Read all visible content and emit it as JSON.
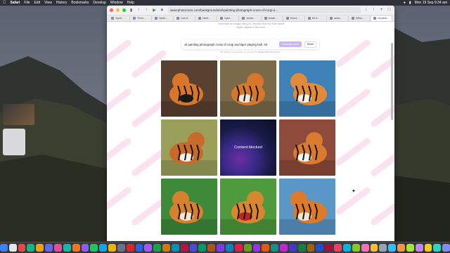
{
  "menubar": {
    "apple": "",
    "items": [
      "Safari",
      "File",
      "Edit",
      "View",
      "History",
      "Bookmarks",
      "Develop",
      "Window",
      "Help"
    ],
    "clock": "Mon 19 Sep 9:34 am"
  },
  "browser": {
    "url": "www.photoroom.com/backgrounds/oil-painting-photograph-cross-of-corgi-a...",
    "tabs": [
      "Synth...",
      "Thum...",
      "Synth...",
      "List of...",
      "Ident...",
      "hybri...",
      "Isolati...",
      "Isolati...",
      "Wood...",
      "ML fr...",
      "rainw...",
      "Diffus...",
      "oil painti..."
    ],
    "active_tab_index": 12
  },
  "page": {
    "top_note_line1": "Generate an image using AI. Beware that the final result",
    "top_note_line2": "might require a few tries.",
    "prompt_value": "oil painting photograph cross of corgi and tiger playing ball, 4K",
    "generate_label": "Generate more",
    "reset_label": "Reset",
    "terms_prefix": "By clicking on Generate, you accept the ",
    "terms_link": "Stable Diffusion license",
    "blocked_label": "Content blocked"
  },
  "tiles": [
    {
      "kind": "image",
      "bg": "#5a4030",
      "subject": "#d9762a",
      "accent": "#1b1b1b"
    },
    {
      "kind": "image",
      "bg": "#7a6a4a",
      "subject": "#d8762b",
      "accent": "#f1e8dc"
    },
    {
      "kind": "image",
      "bg": "#3f82b8",
      "subject": "#e08a3a",
      "accent": "#f6efe5"
    },
    {
      "kind": "image",
      "bg": "#9aa05a",
      "subject": "#c86a2a",
      "accent": "#f4f1ea"
    },
    {
      "kind": "blocked"
    },
    {
      "kind": "image",
      "bg": "#8e4a3a",
      "subject": "#d87a30",
      "accent": "#f5f5f5"
    },
    {
      "kind": "image",
      "bg": "#3e8a3a",
      "subject": "#d7812f",
      "accent": "#efe6d6"
    },
    {
      "kind": "image",
      "bg": "#4e9a3c",
      "subject": "#d9872f",
      "accent": "#b8262a"
    },
    {
      "kind": "image",
      "bg": "#5a96c6",
      "subject": "#de7a2a",
      "accent": "#f0e5d5"
    }
  ],
  "dock_colors": [
    "#3b82f6",
    "#e5e7eb",
    "#ef4444",
    "#10b981",
    "#f59e0b",
    "#6366f1",
    "#ec4899",
    "#14b8a6",
    "#f97316",
    "#8b5cf6",
    "#22c55e",
    "#0ea5e9",
    "#eab308",
    "#64748b",
    "#dc2626",
    "#2563eb",
    "#a855f7",
    "#16a34a",
    "#d97706",
    "#0891b2",
    "#be123c",
    "#4f46e5",
    "#059669",
    "#b45309",
    "#7c3aed",
    "#0284c7",
    "#e11d48",
    "#65a30d",
    "#9333ea",
    "#ea580c",
    "#0d9488",
    "#c026d3",
    "#4338ca",
    "#15803d",
    "#a16207",
    "#1d4ed8",
    "#9f1239",
    "#f43f5e",
    "#06b6d4",
    "#84cc16",
    "#f472b6",
    "#fbbf24",
    "#94a3b8",
    "#38bdf8",
    "#fb923c",
    "#a3e635",
    "#c084fc",
    "#facc15",
    "#2dd4bf",
    "#818cf8"
  ]
}
